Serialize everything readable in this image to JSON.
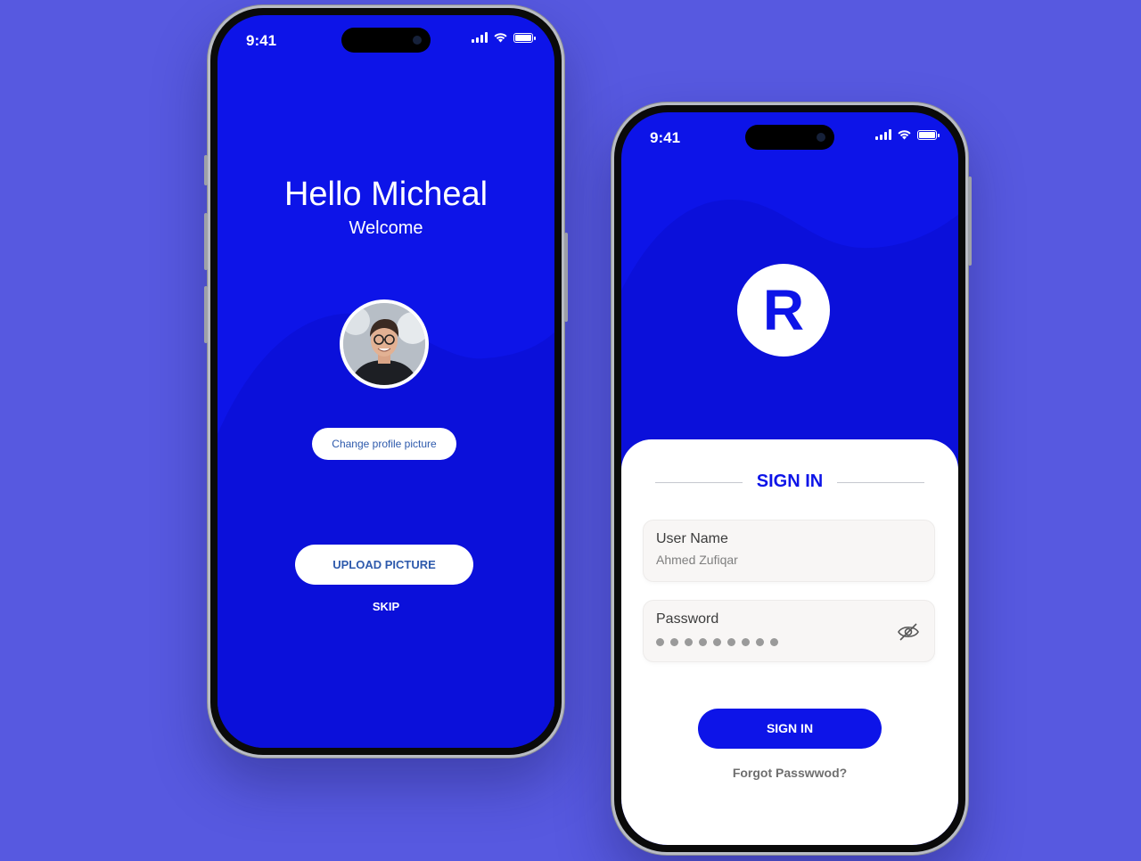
{
  "colors": {
    "background": "#5759E0",
    "brand_blue": "#0D14E8",
    "button_text": "#2E5AAC"
  },
  "status_bar": {
    "time": "9:41",
    "icons": [
      "signal-icon",
      "wifi-icon",
      "battery-icon"
    ]
  },
  "welcome_screen": {
    "greeting": "Hello Micheal",
    "subtitle": "Welcome",
    "avatar_icon": "profile-photo",
    "change_picture_label": "Change profile picture",
    "upload_label": "UPLOAD PICTURE",
    "skip_label": "SKIP"
  },
  "signin_screen": {
    "logo_letter": "R",
    "title": "SIGN IN",
    "username": {
      "label": "User Name",
      "value": "Ahmed Zufiqar"
    },
    "password": {
      "label": "Password",
      "masked": "●●●●●●●●●",
      "toggle_icon": "eye-off-icon"
    },
    "submit_label": "SIGN IN",
    "forgot_label": "Forgot Passwwod?"
  }
}
